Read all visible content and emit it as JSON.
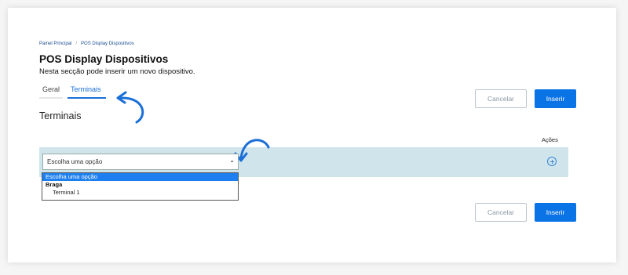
{
  "breadcrumb": {
    "home": "Painel Principal",
    "separator": "/",
    "current": "POS Display Dispositivos"
  },
  "page": {
    "title": "POS Display Dispositivos",
    "subtitle": "Nesta secção pode inserir um novo dispositivo."
  },
  "tabs": [
    {
      "label": "Geral",
      "active": false
    },
    {
      "label": "Terminais",
      "active": true
    }
  ],
  "buttons": {
    "cancel": "Cancelar",
    "insert": "Inserir"
  },
  "section": {
    "title": "Terminais"
  },
  "table": {
    "actions_header": "Ações"
  },
  "select": {
    "value": "Escolha uma opção",
    "options": [
      {
        "label": "Escolha uma opção",
        "type": "option",
        "selected": true
      },
      {
        "label": "Braga",
        "type": "group"
      },
      {
        "label": "Terminal 1",
        "type": "sub"
      }
    ]
  },
  "icons": {
    "add": "plus-circle-icon",
    "annotation": "curved-arrow-icon",
    "chevron": "chevron-down-icon"
  },
  "colors": {
    "primary": "#0a73e6",
    "row_band": "#cfe4eb",
    "annotation_arrow": "#1a6fd8"
  }
}
